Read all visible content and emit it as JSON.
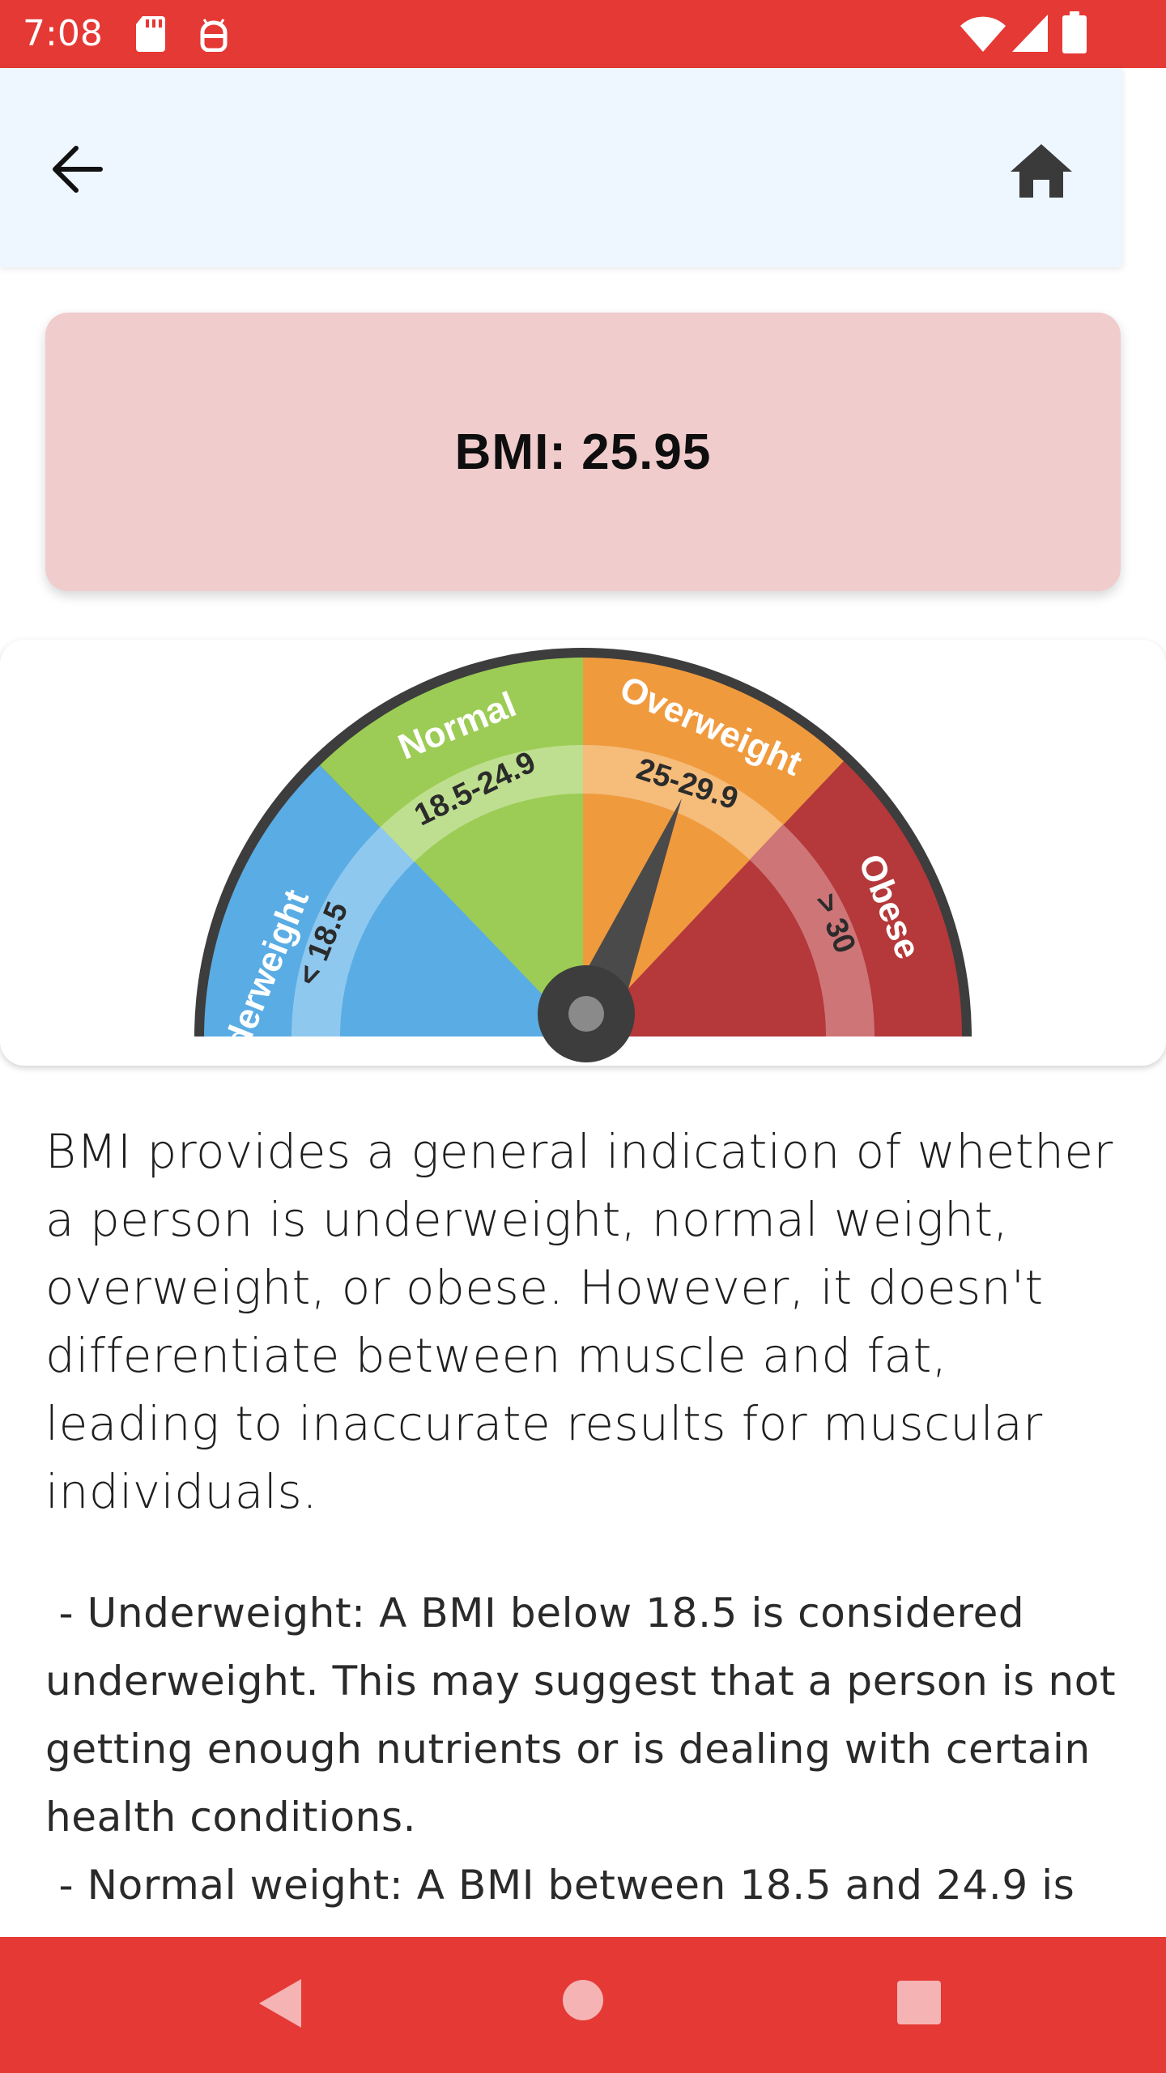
{
  "status_bar": {
    "time": "7:08",
    "icons": [
      "sd-card-icon",
      "notification-icon",
      "wifi-icon",
      "signal-icon",
      "battery-icon"
    ]
  },
  "app_bar": {
    "back_icon": "arrow-back-icon",
    "home_icon": "home-icon",
    "background": "#eef7ff"
  },
  "result": {
    "bmi_text": "BMI: 25.95",
    "card_color": "#f1cccd"
  },
  "gauge": {
    "segments": [
      {
        "name": "Underweight",
        "range": "< 18.5",
        "color": "#5aace4",
        "light": "#8fc8ee"
      },
      {
        "name": "Normal",
        "range": "18.5-24.9",
        "color": "#9ccc55",
        "light": "#bedf8f"
      },
      {
        "name": "Overweight",
        "range": "25-29.9",
        "color": "#f09a3e",
        "light": "#f5bc7a"
      },
      {
        "name": "Obese",
        "range": "> 30",
        "color": "#b5383a",
        "light": "#ce7577"
      }
    ]
  },
  "content": {
    "intro": "BMI provides a general indication of whether a person is underweight, normal weight, overweight, or obese. However, it doesn't differentiate between muscle and fat, leading to inaccurate results for muscular individuals.",
    "details": " - Underweight: A BMI below 18.5 is considered underweight. This may suggest that a person is not getting enough nutrients or is dealing with certain health conditions.\n - Normal weight: A BMI between 18.5 and 24.9 is"
  },
  "nav_bar": {
    "icons": [
      "nav-back-icon",
      "nav-home-icon",
      "nav-recents-icon"
    ],
    "color": "#e53935"
  }
}
